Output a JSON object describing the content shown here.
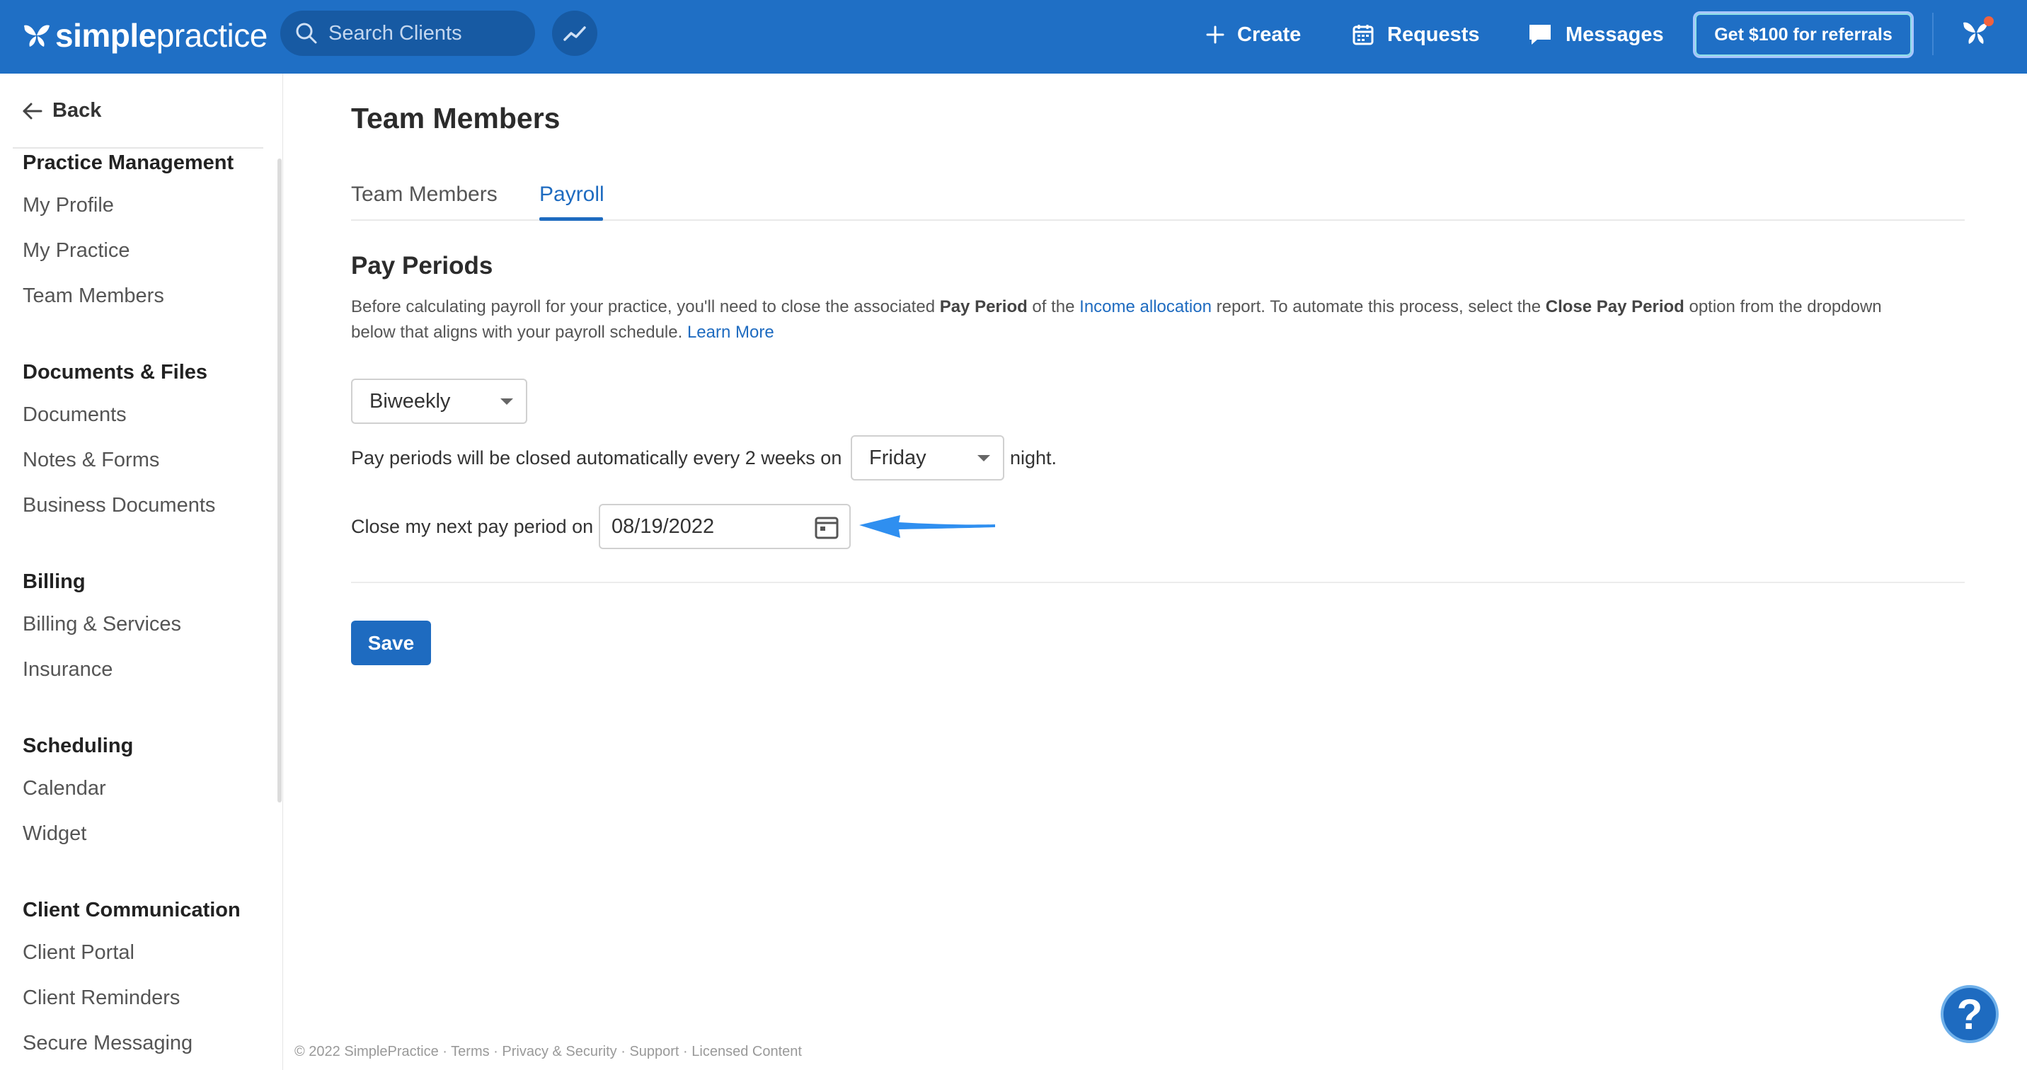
{
  "navbar": {
    "logo_bold": "simple",
    "logo_light": "practice",
    "search_placeholder": "Search Clients",
    "create_label": "Create",
    "requests_label": "Requests",
    "messages_label": "Messages",
    "referral_label": "Get $100 for referrals",
    "icons": [
      "butterfly-icon",
      "search-icon",
      "trend-chart-icon",
      "plus-icon",
      "calendar-icon",
      "chat-bubble-icon"
    ]
  },
  "sidebar": {
    "back_label": "Back",
    "sections": [
      {
        "title": "Practice Management",
        "items": [
          "My Profile",
          "My Practice",
          "Team Members"
        ]
      },
      {
        "title": "Documents & Files",
        "items": [
          "Documents",
          "Notes & Forms",
          "Business Documents"
        ]
      },
      {
        "title": "Billing",
        "items": [
          "Billing & Services",
          "Insurance"
        ]
      },
      {
        "title": "Scheduling",
        "items": [
          "Calendar",
          "Widget"
        ]
      },
      {
        "title": "Client Communication",
        "items": [
          "Client Portal",
          "Client Reminders",
          "Secure Messaging"
        ]
      }
    ]
  },
  "main": {
    "page_title": "Team Members",
    "tabs": [
      {
        "label": "Team Members",
        "active": false
      },
      {
        "label": "Payroll",
        "active": true
      }
    ],
    "section_heading": "Pay Periods",
    "description": {
      "part1": "Before calculating payroll for your practice, you'll need to close the associated ",
      "bold1": "Pay Period",
      "part2": " of the ",
      "link1": "Income allocation",
      "part3": " report. To automate this process, select the ",
      "bold2": "Close Pay Period",
      "part4": " option from the dropdown below that aligns with your payroll schedule. ",
      "link2": "Learn More"
    },
    "frequency_value": "Biweekly",
    "auto_close_prefix": "Pay periods will be closed automatically every 2 weeks on",
    "day_value": "Friday",
    "auto_close_suffix": "night.",
    "next_close_label": "Close my next pay period on",
    "next_close_date": "08/19/2022",
    "save_label": "Save"
  },
  "footer": {
    "copyright": "© 2022 SimplePractice",
    "links": [
      "Terms",
      "Privacy & Security",
      "Support",
      "Licensed Content"
    ],
    "separator": " · "
  },
  "help_label": "?",
  "colors": {
    "navbar": "#1f6fc5",
    "accent": "#1e6bc0",
    "annotation_arrow": "#2f8ff0"
  }
}
